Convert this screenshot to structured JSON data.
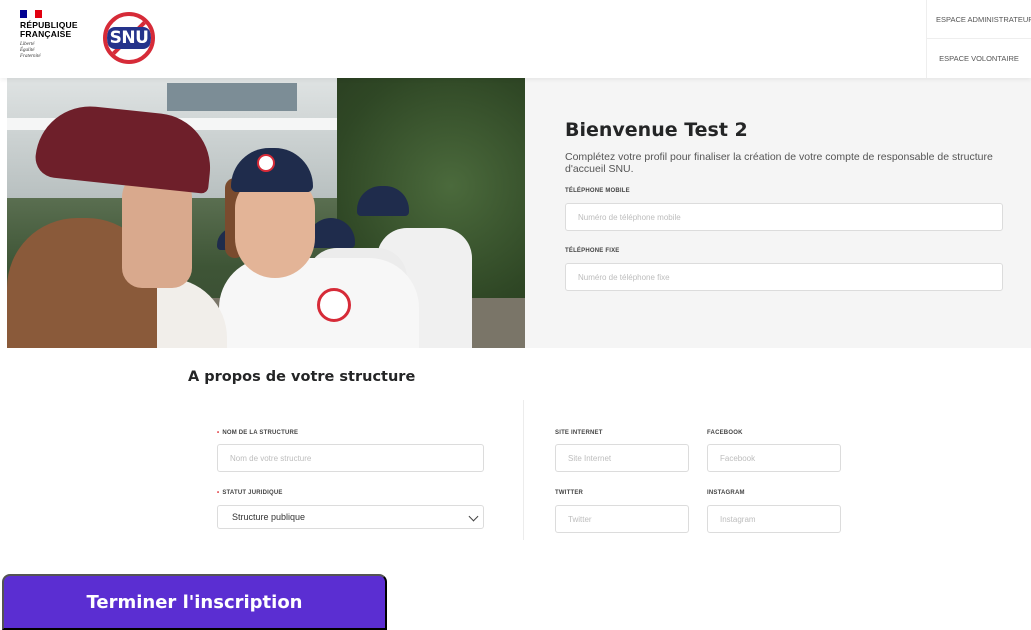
{
  "header": {
    "marianne": {
      "line1": "RÉPUBLIQUE",
      "line2": "FRANÇAISE",
      "devise1": "Liberté",
      "devise2": "Égalité",
      "devise3": "Fraternité"
    },
    "logo_text": "SNU",
    "nav": {
      "admin": "ESPACE ADMINISTRATEUR",
      "volunteer": "ESPACE VOLONTAIRE"
    }
  },
  "hero": {
    "title": "Bienvenue Test 2",
    "subtitle": "Complétez votre profil pour finaliser la création de votre compte de responsable de structure d'accueil SNU.",
    "mobile_label": "TÉLÉPHONE MOBILE",
    "mobile_placeholder": "Numéro de téléphone mobile",
    "fixe_label": "TÉLÉPHONE FIXE",
    "fixe_placeholder": "Numéro de téléphone fixe"
  },
  "structure": {
    "title": "A propos de votre structure",
    "required_mark": "•",
    "name_label": "NOM DE LA STRUCTURE",
    "name_placeholder": "Nom de votre structure",
    "statut_label": "STATUT JURIDIQUE",
    "statut_value": "Structure publique",
    "website_label": "SITE INTERNET",
    "website_placeholder": "Site Internet",
    "facebook_label": "FACEBOOK",
    "facebook_placeholder": "Facebook",
    "twitter_label": "TWITTER",
    "twitter_placeholder": "Twitter",
    "instagram_label": "INSTAGRAM",
    "instagram_placeholder": "Instagram"
  },
  "submit_label": "Terminer l'inscription",
  "colors": {
    "accent": "#5b2ed2",
    "required": "#e0373c",
    "logo_red": "#d62b38",
    "logo_blue": "#25338b"
  }
}
